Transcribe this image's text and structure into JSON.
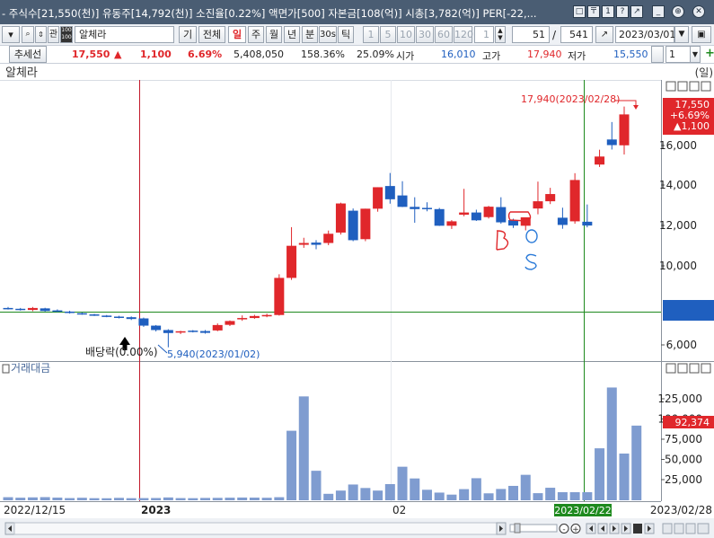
{
  "titlebar": {
    "text": "- 주식수[21,550(천)] 유동주[14,792(천)] 소진율[0.22%] 액면가[500] 자본금[108(억)] 시총[3,782(억)] PER[-22,...",
    "buttons": [
      "□",
      "〒",
      "1",
      "?",
      "↗",
      "_",
      "⊕",
      "✕"
    ]
  },
  "toolbar": {
    "stock_code_label": "관",
    "stock_name": "알체라",
    "periods": [
      "기",
      "전체",
      "일",
      "주",
      "월",
      "년",
      "분",
      "30s",
      "틱"
    ],
    "selected_period": "일",
    "intervals": [
      "1",
      "5",
      "10",
      "30",
      "60",
      "120"
    ],
    "interval_value": "1",
    "count_value": "51",
    "count_separator": "/",
    "total_value": "541",
    "date_value": "2023/03/01"
  },
  "quote": {
    "trend_label": "추세선",
    "price": "17,550",
    "change_arrow": "▲",
    "change": "1,100",
    "change_pct": "6.69%",
    "volume": "5,408,050",
    "volume_ratio": "158.36%",
    "turnover": "25.09%",
    "open_label": "시가",
    "open": "16,010",
    "high_label": "고가",
    "high": "17,940",
    "low_label": "저가",
    "low": "15,550",
    "spin_value": "1"
  },
  "chart_header": {
    "title": "알체라",
    "unit": "(일)",
    "volume_title": "거래대금"
  },
  "annotations": {
    "high_marker": "17,940(2023/02/28)",
    "low_marker": "5,940(2023/01/02)",
    "dividend": "배당락(0.00%)",
    "last_price": "17,550",
    "last_pct": "+6.69%",
    "last_change": "▲1,100",
    "last_volume": "92,374",
    "crosshair_date": "2023/02/22"
  },
  "colors": {
    "up": "#e0272b",
    "down": "#1f5fbf",
    "volume": "#7f9cd0",
    "titlebar": "#4a5d73",
    "crosshair": "#1e8a1e"
  },
  "chart_data": {
    "type": "candlestick",
    "x_labels": [
      "2022/12/15",
      "2023",
      "02",
      "2023/02/28"
    ],
    "y_ticks": [
      "16,000",
      "14,000",
      "12,000",
      "10,000",
      "6,000"
    ],
    "volume_ticks": [
      "125,000",
      "100,000",
      "75,000",
      "50,000",
      "25,000"
    ],
    "ylim": [
      5000,
      19500
    ],
    "volume_ylim": [
      0,
      160000
    ],
    "candles": [
      {
        "o": 7900,
        "h": 7950,
        "l": 7820,
        "c": 7860
      },
      {
        "o": 7860,
        "h": 7900,
        "l": 7770,
        "c": 7800
      },
      {
        "o": 7800,
        "h": 7950,
        "l": 7740,
        "c": 7900
      },
      {
        "o": 7880,
        "h": 7910,
        "l": 7720,
        "c": 7750
      },
      {
        "o": 7780,
        "h": 7830,
        "l": 7700,
        "c": 7720
      },
      {
        "o": 7720,
        "h": 7760,
        "l": 7620,
        "c": 7650
      },
      {
        "o": 7640,
        "h": 7680,
        "l": 7560,
        "c": 7590
      },
      {
        "o": 7580,
        "h": 7610,
        "l": 7500,
        "c": 7530
      },
      {
        "o": 7520,
        "h": 7550,
        "l": 7440,
        "c": 7470
      },
      {
        "o": 7470,
        "h": 7510,
        "l": 7380,
        "c": 7420
      },
      {
        "o": 7440,
        "h": 7480,
        "l": 7300,
        "c": 7350
      },
      {
        "o": 7380,
        "h": 7420,
        "l": 6960,
        "c": 7020
      },
      {
        "o": 7020,
        "h": 7050,
        "l": 6730,
        "c": 6800
      },
      {
        "o": 6800,
        "h": 6840,
        "l": 5940,
        "c": 6650
      },
      {
        "o": 6680,
        "h": 6760,
        "l": 6600,
        "c": 6740
      },
      {
        "o": 6770,
        "h": 6800,
        "l": 6680,
        "c": 6720
      },
      {
        "o": 6750,
        "h": 6800,
        "l": 6620,
        "c": 6660
      },
      {
        "o": 6780,
        "h": 7130,
        "l": 6740,
        "c": 7050
      },
      {
        "o": 7060,
        "h": 7280,
        "l": 7000,
        "c": 7250
      },
      {
        "o": 7350,
        "h": 7530,
        "l": 7260,
        "c": 7400
      },
      {
        "o": 7400,
        "h": 7560,
        "l": 7360,
        "c": 7500
      },
      {
        "o": 7500,
        "h": 7620,
        "l": 7440,
        "c": 7550
      },
      {
        "o": 7550,
        "h": 9580,
        "l": 7520,
        "c": 9400
      },
      {
        "o": 9400,
        "h": 11930,
        "l": 9300,
        "c": 11000
      },
      {
        "o": 11050,
        "h": 11400,
        "l": 10900,
        "c": 11140
      },
      {
        "o": 11160,
        "h": 11280,
        "l": 10830,
        "c": 11050
      },
      {
        "o": 11140,
        "h": 11760,
        "l": 11030,
        "c": 11600
      },
      {
        "o": 11660,
        "h": 13150,
        "l": 11560,
        "c": 13110
      },
      {
        "o": 12750,
        "h": 12860,
        "l": 11230,
        "c": 11280
      },
      {
        "o": 11330,
        "h": 12850,
        "l": 11230,
        "c": 12850
      },
      {
        "o": 12850,
        "h": 13920,
        "l": 12700,
        "c": 13920
      },
      {
        "o": 13980,
        "h": 14630,
        "l": 13100,
        "c": 13320
      },
      {
        "o": 13510,
        "h": 14220,
        "l": 12930,
        "c": 12940
      },
      {
        "o": 12940,
        "h": 13420,
        "l": 12150,
        "c": 12830
      },
      {
        "o": 12890,
        "h": 13170,
        "l": 12720,
        "c": 12830
      },
      {
        "o": 12830,
        "h": 12890,
        "l": 11990,
        "c": 12000
      },
      {
        "o": 12000,
        "h": 12280,
        "l": 11840,
        "c": 12220
      },
      {
        "o": 12550,
        "h": 13840,
        "l": 12470,
        "c": 12660
      },
      {
        "o": 12660,
        "h": 12800,
        "l": 12240,
        "c": 12270
      },
      {
        "o": 12430,
        "h": 12990,
        "l": 12360,
        "c": 12950
      },
      {
        "o": 12930,
        "h": 13420,
        "l": 12100,
        "c": 12170
      },
      {
        "o": 12280,
        "h": 12350,
        "l": 11890,
        "c": 12010
      },
      {
        "o": 12000,
        "h": 12390,
        "l": 11770,
        "c": 12420
      },
      {
        "o": 12860,
        "h": 14200,
        "l": 12570,
        "c": 13220
      },
      {
        "o": 13220,
        "h": 13890,
        "l": 13080,
        "c": 13580
      },
      {
        "o": 12400,
        "h": 12900,
        "l": 11850,
        "c": 12040
      },
      {
        "o": 12220,
        "h": 14620,
        "l": 12100,
        "c": 14280
      },
      {
        "o": 12200,
        "h": 13060,
        "l": 11920,
        "c": 12010
      },
      {
        "o": 15050,
        "h": 15790,
        "l": 14930,
        "c": 15450
      },
      {
        "o": 16300,
        "h": 17170,
        "l": 15800,
        "c": 16020
      },
      {
        "o": 16010,
        "h": 17940,
        "l": 15550,
        "c": 17550
      }
    ],
    "volumes": [
      3800,
      3200,
      3600,
      3900,
      3300,
      2700,
      3100,
      2600,
      2500,
      3000,
      2600,
      2700,
      2800,
      3500,
      2700,
      2600,
      2900,
      3000,
      3200,
      3400,
      3300,
      3100,
      3800,
      86000,
      128500,
      36500,
      8000,
      12000,
      19500,
      15200,
      12000,
      20000,
      41500,
      27000,
      13000,
      9500,
      7000,
      13800,
      27300,
      8600,
      14000,
      17800,
      31500,
      8800,
      15500,
      10000,
      10000,
      10000,
      64300,
      139500,
      57800,
      92374
    ]
  }
}
